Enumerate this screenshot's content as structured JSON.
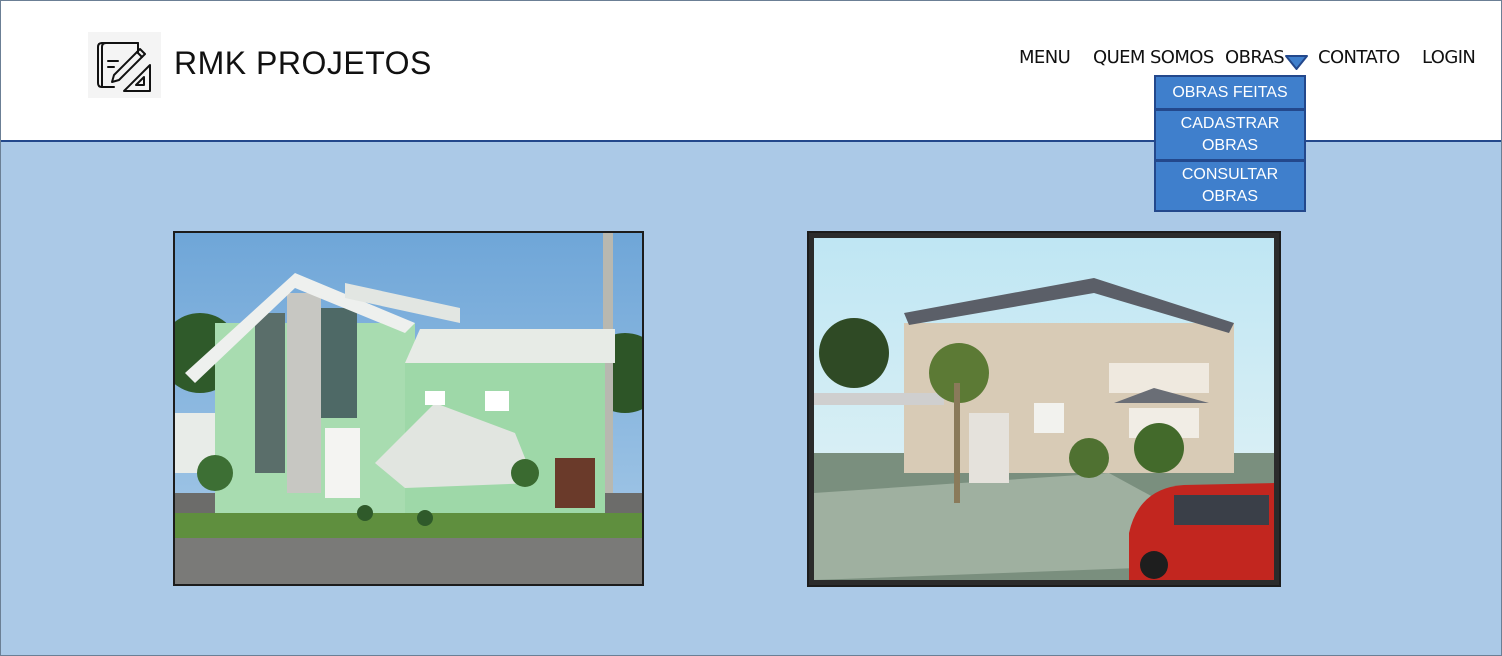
{
  "header": {
    "brand": "RMK PROJETOS",
    "logo_icon": "blueprint-drafting-icon"
  },
  "nav": {
    "items": [
      {
        "label": "MENU"
      },
      {
        "label": "QUEM SOMOS"
      },
      {
        "label": "OBRAS"
      },
      {
        "label": "CONTATO"
      },
      {
        "label": "LOGIN"
      }
    ],
    "obras_caret_icon": "triangle-down-icon"
  },
  "dropdown": {
    "items": [
      {
        "label": "OBRAS FEITAS"
      },
      {
        "label": "CADASTRAR OBRAS"
      },
      {
        "label": "CONSULTAR OBRAS"
      }
    ]
  },
  "gallery": {
    "photos": [
      {
        "subject": "house-photo-green"
      },
      {
        "subject": "house-photo-beige"
      }
    ]
  },
  "colors": {
    "page_background": "#abc9e7",
    "header_border": "#23488c",
    "dropdown_background": "#3f7fcc",
    "dropdown_border": "#23488c"
  }
}
